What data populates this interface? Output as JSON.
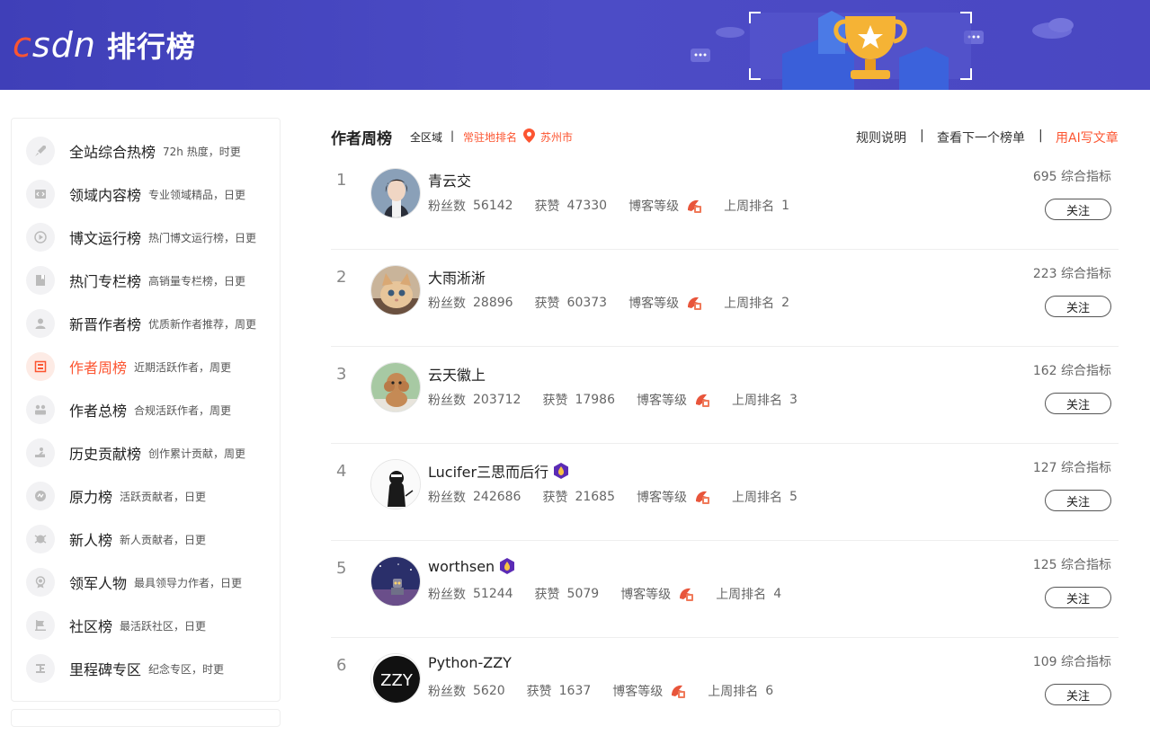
{
  "header": {
    "logo_text": "CSDN",
    "title": "排行榜"
  },
  "sidebar": {
    "items": [
      {
        "name": "全站综合热榜",
        "desc": "72h 热度，时更",
        "icon": "rocket-icon"
      },
      {
        "name": "领域内容榜",
        "desc": "专业领域精品，日更",
        "icon": "code-icon"
      },
      {
        "name": "博文运行榜",
        "desc": "热门博文运行榜，日更",
        "icon": "play-icon"
      },
      {
        "name": "热门专栏榜",
        "desc": "高销量专栏榜，日更",
        "icon": "bookmark-icon"
      },
      {
        "name": "新晋作者榜",
        "desc": "优质新作者推荐，周更",
        "icon": "user-icon"
      },
      {
        "name": "作者周榜",
        "desc": "近期活跃作者，周更",
        "icon": "calendar-icon",
        "active": true
      },
      {
        "name": "作者总榜",
        "desc": "合规活跃作者，周更",
        "icon": "group-icon"
      },
      {
        "name": "历史贡献榜",
        "desc": "创作累计贡献，周更",
        "icon": "hand-icon"
      },
      {
        "name": "原力榜",
        "desc": "活跃贡献者，日更",
        "icon": "force-icon"
      },
      {
        "name": "新人榜",
        "desc": "新人贡献者，日更",
        "icon": "newbie-icon"
      },
      {
        "name": "领军人物",
        "desc": "最具领导力作者，日更",
        "icon": "medal-icon"
      },
      {
        "name": "社区榜",
        "desc": "最活跃社区，日更",
        "icon": "flag-icon"
      },
      {
        "name": "里程碑专区",
        "desc": "纪念专区，时更",
        "icon": "milestone-icon"
      }
    ]
  },
  "toolbar": {
    "title": "作者周榜",
    "filter_all": "全区域",
    "filter_sep": "|",
    "filter_local": "常驻地排名",
    "city": "苏州市",
    "rules": "规则说明",
    "sep": "|",
    "next_board": "查看下一个榜单",
    "ai_write": "用AI写文章"
  },
  "labels": {
    "fans": "粉丝数",
    "likes": "获赞",
    "level": "博客等级",
    "last_rank": "上周排名",
    "score_suffix": "综合指标",
    "follow": "关注"
  },
  "rows": [
    {
      "rank": "1",
      "name": "青云交",
      "fans": "56142",
      "likes": "47330",
      "last_rank": "1",
      "score": "695 综合指标",
      "vip": false,
      "avatar": "woman-portrait"
    },
    {
      "rank": "2",
      "name": "大雨淅淅",
      "fans": "28896",
      "likes": "60373",
      "last_rank": "2",
      "score": "223 综合指标",
      "vip": false,
      "avatar": "cat"
    },
    {
      "rank": "3",
      "name": "云天徽上",
      "fans": "203712",
      "likes": "17986",
      "last_rank": "3",
      "score": "162 综合指标",
      "vip": false,
      "avatar": "poodle"
    },
    {
      "rank": "4",
      "name": "Lucifer三思而后行",
      "fans": "242686",
      "likes": "21685",
      "last_rank": "5",
      "score": "127 综合指标",
      "vip": true,
      "avatar": "sketch"
    },
    {
      "rank": "5",
      "name": "worthsen",
      "fans": "51244",
      "likes": "5079",
      "last_rank": "4",
      "score": "125 综合指标",
      "vip": true,
      "avatar": "night-robot"
    },
    {
      "rank": "6",
      "name": "Python-ZZY",
      "fans": "5620",
      "likes": "1637",
      "last_rank": "6",
      "score": "109 综合指标",
      "vip": false,
      "avatar": "zzy-logo"
    }
  ],
  "colors": {
    "brand": "#fc5531",
    "header_bg": "#4545bf"
  }
}
